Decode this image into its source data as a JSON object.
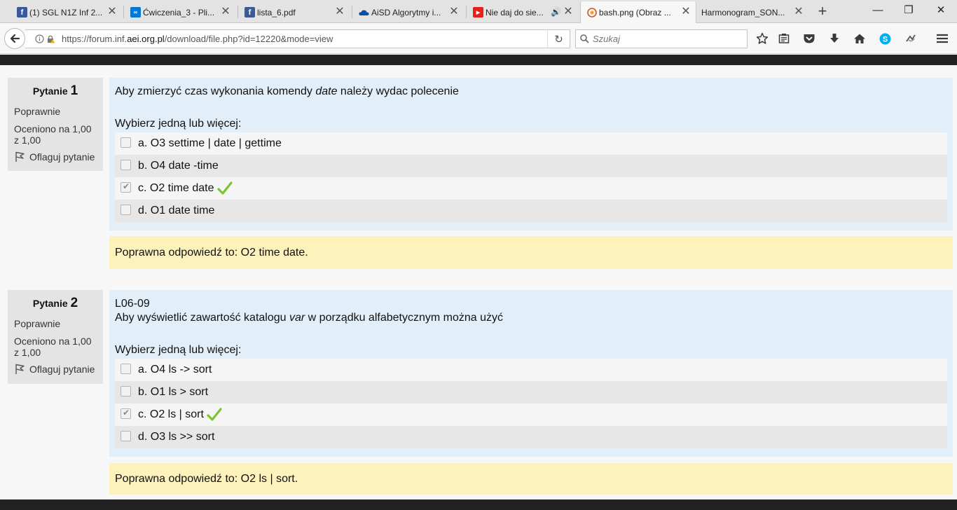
{
  "browser": {
    "tabs": [
      {
        "title": "(1) SGL N1Z Inf 2...",
        "icon": "facebook-icon",
        "color": "#3b5998"
      },
      {
        "title": "Ćwiczenia_3 - Pli...",
        "icon": "office-icon",
        "color": "#0078d7"
      },
      {
        "title": "lista_6.pdf",
        "icon": "facebook-icon",
        "color": "#3b5998"
      },
      {
        "title": "AiSD Algorytmy i...",
        "icon": "onedrive-icon",
        "color": "#0a4ea3"
      },
      {
        "title": "Nie daj do sie...",
        "icon": "youtube-icon",
        "color": "#e62117"
      },
      {
        "title": "bash.png (Obraz ...",
        "icon": "image-icon",
        "color": "#d9531e"
      },
      {
        "title": "Harmonogram_SON...",
        "icon": "",
        "color": ""
      }
    ],
    "url": {
      "prefix": "https://forum.inf.",
      "domain": "aei.org.pl",
      "suffix": "/download/file.php?id=12220&mode=view"
    },
    "search_placeholder": "Szukaj"
  },
  "questions": [
    {
      "label": "Pytanie",
      "number": "1",
      "state": "Poprawnie",
      "grade": "Oceniono na 1,00 z 1,00",
      "flag": "Oflaguj pytanie",
      "code": "",
      "text_before": "Aby zmierzyć czas wykonania komendy ",
      "text_italic": "date",
      "text_after": " należy wydac polecenie",
      "prompt": "Wybierz jedną lub więcej:",
      "answers": [
        {
          "label": "a. O3 settime | date | gettime",
          "checked": false,
          "correct": false
        },
        {
          "label": "b. O4 date -time",
          "checked": false,
          "correct": false
        },
        {
          "label": "c. O2 time date",
          "checked": true,
          "correct": true
        },
        {
          "label": "d. O1 date time",
          "checked": false,
          "correct": false
        }
      ],
      "feedback": "Poprawna odpowiedź to: O2 time date."
    },
    {
      "label": "Pytanie",
      "number": "2",
      "state": "Poprawnie",
      "grade": "Oceniono na 1,00 z 1,00",
      "flag": "Oflaguj pytanie",
      "code": "L06-09",
      "text_before": "Aby wyświetlić zawartość katalogu ",
      "text_italic": "var",
      "text_after": " w porządku alfabetycznym można użyć",
      "prompt": "Wybierz jedną lub więcej:",
      "answers": [
        {
          "label": "a. O4 ls -> sort",
          "checked": false,
          "correct": false
        },
        {
          "label": "b. O1 ls > sort",
          "checked": false,
          "correct": false
        },
        {
          "label": "c. O2 ls | sort",
          "checked": true,
          "correct": true
        },
        {
          "label": "d. O3 ls >> sort",
          "checked": false,
          "correct": false
        }
      ],
      "feedback": "Poprawna odpowiedź to: O2 ls | sort."
    }
  ],
  "colors": {
    "info_bg": "#e4e4e4",
    "formulation_bg": "#e2eef8",
    "feedback_bg": "#fdf1bc",
    "tick": "#7cc532"
  }
}
